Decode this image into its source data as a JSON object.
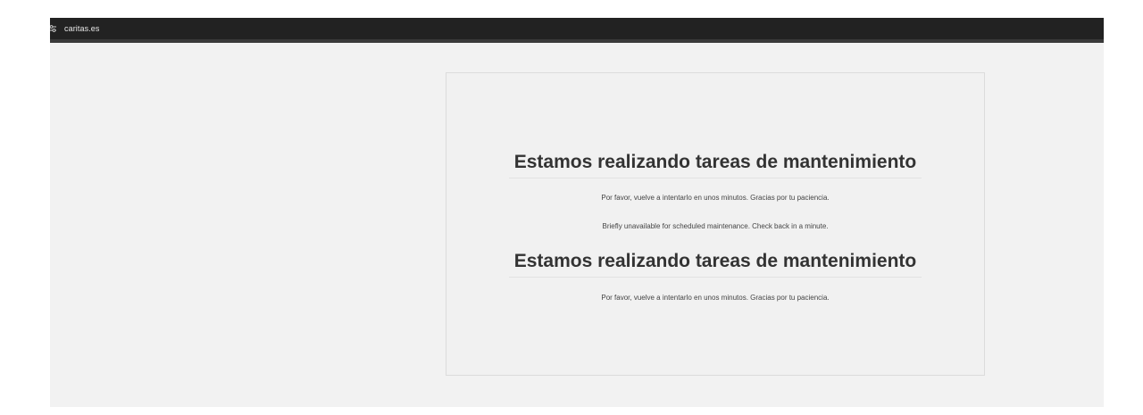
{
  "window": {
    "title": "caritas.es",
    "icon": "tune-icon"
  },
  "maintenance": {
    "heading_1": "Estamos realizando tareas de mantenimiento",
    "message_es_1": "Por favor, vuelve a intentarlo en unos minutos. Gracias por tu paciencia.",
    "message_en": "Briefly unavailable for scheduled maintenance. Check back in a minute.",
    "heading_2": "Estamos realizando tareas de mantenimiento",
    "message_es_2": "Por favor, vuelve a intentarlo en unos minutos. Gracias por tu paciencia."
  },
  "colors": {
    "titlebar": "#222222",
    "page_background": "#f2f2f2",
    "heading_text": "#333333"
  }
}
